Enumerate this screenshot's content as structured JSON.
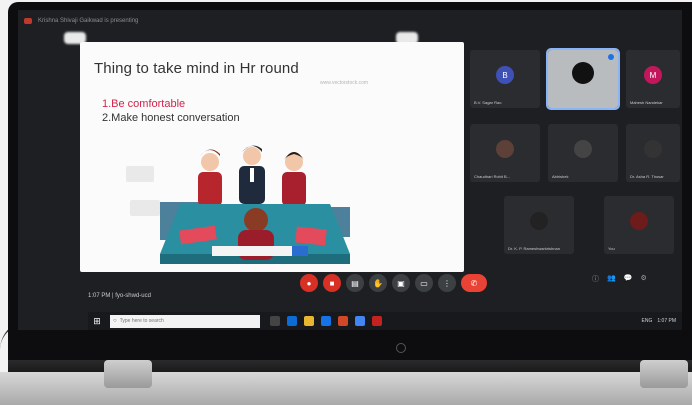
{
  "meeting": {
    "presenter_notice": "Krishna Shivaji Gaikwad is presenting"
  },
  "slide": {
    "title": "Thing to take mind in Hr round",
    "points": [
      "1.Be comfortable",
      "2.Make honest conversation"
    ],
    "watermark": "www.vectorstock.com"
  },
  "status": {
    "time": "1:07 PM",
    "meeting_code": "fyo-shwd-ucd"
  },
  "controls": [
    {
      "name": "mic-off-icon",
      "glyph": "●"
    },
    {
      "name": "camera-off-icon",
      "glyph": "■"
    },
    {
      "name": "captions-icon",
      "glyph": "▤"
    },
    {
      "name": "raise-hand-icon",
      "glyph": "✋"
    },
    {
      "name": "present-icon",
      "glyph": "▣"
    },
    {
      "name": "more-options-icon",
      "glyph": "⋮"
    }
  ],
  "right_controls": [
    "ⓘ",
    "👥",
    "💬",
    "⚙"
  ],
  "participants": [
    {
      "initial": "B",
      "name": "B.V. Sagar Rao",
      "color": "#3f51b5"
    },
    {
      "initial": "",
      "name": "",
      "color": "#111111"
    },
    {
      "initial": "M",
      "name": "Mahesh Nandekar",
      "color": "#c2185b"
    },
    {
      "initial": "",
      "name": "Chaudhari Rohit B...",
      "color": "#5d4037"
    },
    {
      "initial": "",
      "name": "Abhishek",
      "color": "#444444"
    },
    {
      "initial": "",
      "name": "Dr. Asha R. Thosar",
      "color": "#333333"
    },
    {
      "initial": "",
      "name": "Dr. K. P. Rameshwarkrishnan",
      "color": "#222222"
    },
    {
      "initial": "",
      "name": "You",
      "color": "#6d1b1b"
    }
  ],
  "taskbar": {
    "search_placeholder": "Type here to search",
    "tray": [
      "ENG",
      "1:07 PM"
    ]
  }
}
